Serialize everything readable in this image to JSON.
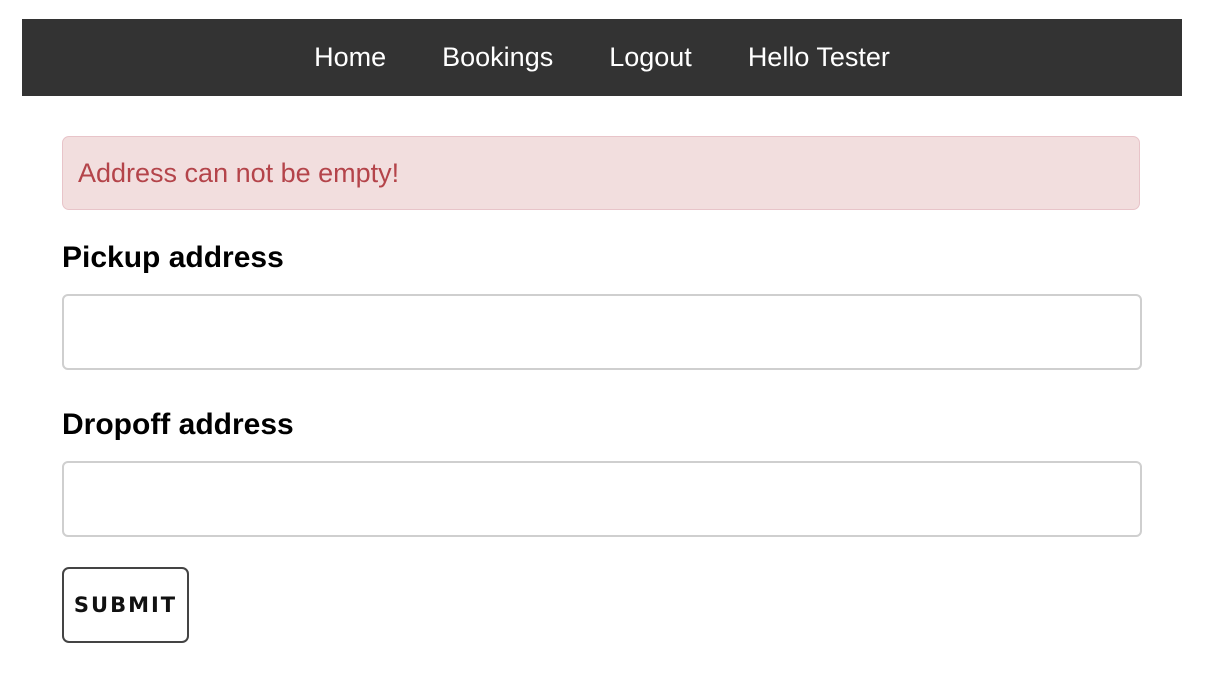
{
  "nav": {
    "items": [
      {
        "label": "Home"
      },
      {
        "label": "Bookings"
      },
      {
        "label": "Logout"
      },
      {
        "label": "Hello Tester"
      }
    ]
  },
  "alert": {
    "message": "Address can not be empty!"
  },
  "form": {
    "pickup": {
      "label": "Pickup address",
      "value": "",
      "placeholder": ""
    },
    "dropoff": {
      "label": "Dropoff address",
      "value": "",
      "placeholder": ""
    },
    "submit_label": "SUBMIT"
  },
  "colors": {
    "navbar_bg": "#333333",
    "alert_bg": "#f2dede",
    "alert_text": "#b4444a"
  }
}
